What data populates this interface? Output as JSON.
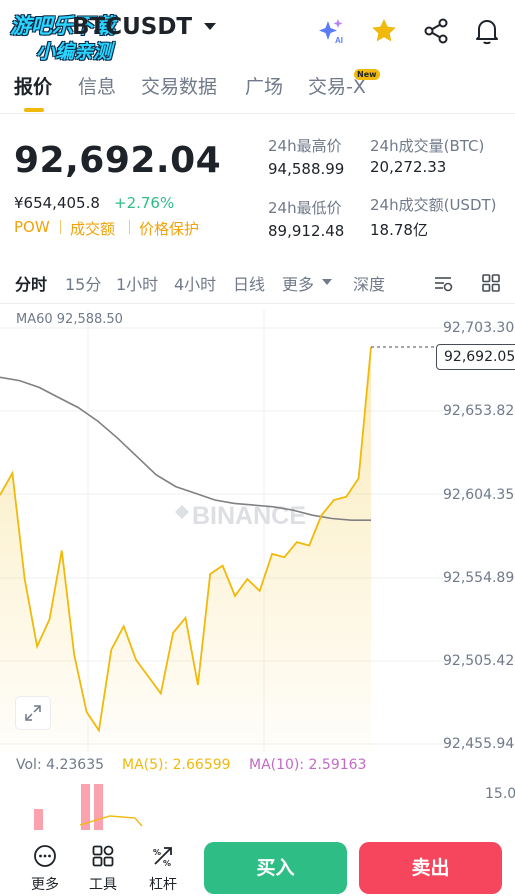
{
  "header": {
    "pair": "BTCUSDT",
    "watermark_line1": "游吧乐下载",
    "watermark_line2": "小编亲测"
  },
  "tabs": [
    {
      "label": "报价",
      "active": true
    },
    {
      "label": "信息",
      "active": false
    },
    {
      "label": "交易数据",
      "active": false
    },
    {
      "label": "广场",
      "active": false
    },
    {
      "label": "交易-X",
      "active": false
    }
  ],
  "new_badge": "New",
  "ticker": {
    "last_price": "92,692.04",
    "cny_price": "¥654,405.8",
    "change": "+2.76%",
    "tags": [
      "POW",
      "成交额",
      "价格保护"
    ]
  },
  "stats": {
    "high_label": "24h最高价",
    "high_value": "94,588.99",
    "low_label": "24h最低价",
    "low_value": "89,912.48",
    "vol_btc_label": "24h成交量(BTC)",
    "vol_btc_value": "20,272.33",
    "vol_usdt_label": "24h成交额(USDT)",
    "vol_usdt_value": "18.78亿"
  },
  "intervals": [
    {
      "label": "分时",
      "active": true
    },
    {
      "label": "15分",
      "active": false
    },
    {
      "label": "1小时",
      "active": false
    },
    {
      "label": "4小时",
      "active": false
    },
    {
      "label": "日线",
      "active": false
    },
    {
      "label": "更多",
      "active": false
    },
    {
      "label": "深度",
      "active": false
    }
  ],
  "chart": {
    "ma60_label": "MA60 92,588.50",
    "watermark": "BINANCE",
    "y_ticks": [
      "92,703.30",
      "92,653.82",
      "92,604.35",
      "92,554.89",
      "92,505.42",
      "92,455.94"
    ],
    "last_price_tag": "92,692.05"
  },
  "chart_data": {
    "type": "line",
    "y_axis_labels": [
      "92,703.30",
      "92,653.82",
      "92,604.35",
      "92,554.89",
      "92,505.42",
      "92,455.94"
    ],
    "ylim": [
      92455.94,
      92703.3
    ],
    "grid": true,
    "series": [
      {
        "name": "price",
        "color": "#f0b90b",
        "values": [
          92604,
          92617,
          92554,
          92514,
          92530,
          92571,
          92509,
          92475,
          92464,
          92512,
          92526,
          92506,
          92496,
          92486,
          92522,
          92531,
          92491,
          92557,
          92562,
          92544,
          92554,
          92547,
          92569,
          92567,
          92576,
          92574,
          92592,
          92601,
          92603,
          92614,
          92692
        ]
      },
      {
        "name": "MA60",
        "color": "#808080",
        "values": [
          92674,
          92672,
          92668,
          92662,
          92656,
          92648,
          92638,
          92627,
          92616,
          92609,
          92605,
          92601,
          92599,
          92598,
          92597,
          92595,
          92592,
          92590,
          92589,
          92589
        ]
      }
    ]
  },
  "volume": {
    "vol_label": "Vol: 4.23635",
    "ma5_label": "MA(5): 2.66599",
    "ma10_label": "MA(10): 2.59163",
    "y_tick": "15.0"
  },
  "bottom": {
    "more_label": "更多",
    "tools_label": "工具",
    "leverage_label": "杠杆",
    "buy_label": "买入",
    "sell_label": "卖出"
  },
  "colors": {
    "brand": "#f0b90b",
    "up": "#2ebd85",
    "down": "#f6465d",
    "tag": "#f0a30b"
  }
}
